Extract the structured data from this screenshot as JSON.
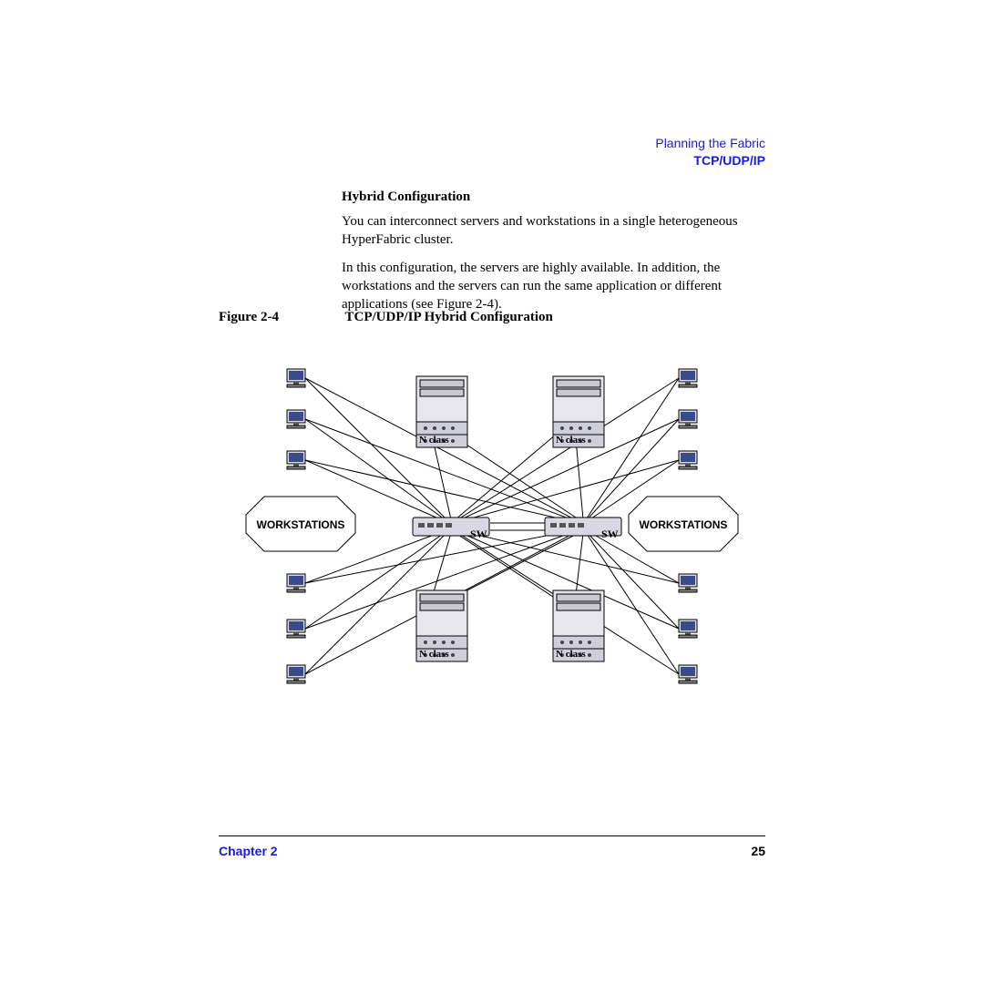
{
  "header": {
    "chapterPath": "Planning the Fabric",
    "section": "TCP/UDP/IP"
  },
  "content": {
    "subhead": "Hybrid Configuration",
    "p1": "You can interconnect servers and workstations in a single heterogeneous HyperFabric cluster.",
    "p2": "In this configuration, the servers are highly available. In addition, the workstations and the servers can run the same application or different applications (see Figure 2-4)."
  },
  "figure": {
    "label": "Figure 2-4",
    "title": "TCP/UDP/IP Hybrid Configuration"
  },
  "diagram": {
    "wsLeft": "WORKSTATIONS",
    "wsRight": "WORKSTATIONS",
    "nclass": "N class",
    "sw": "SW"
  },
  "footer": {
    "chapter": "Chapter 2",
    "page": "25"
  }
}
